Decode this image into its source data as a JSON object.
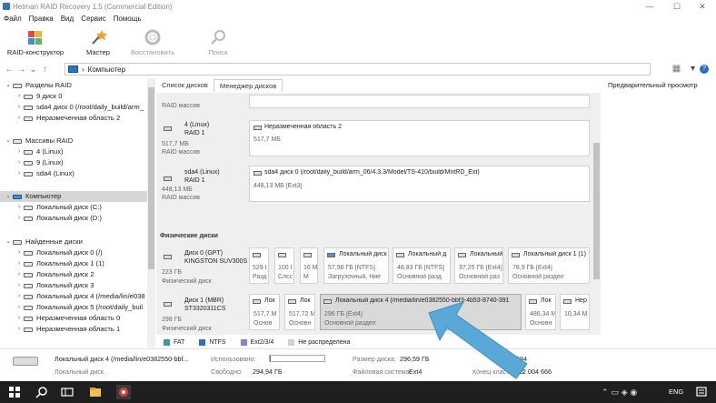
{
  "window": {
    "title": "Hetman RAID Recovery 1.5 (Commercial Edition)",
    "min": "—",
    "max": "☐",
    "close": "✕"
  },
  "menu": [
    "Файл",
    "Правка",
    "Вид",
    "Сервис",
    "Помощь"
  ],
  "toolbar": {
    "raid_builder": "RAID-конструктор",
    "wizard": "Мастер",
    "restore": "Восстановить",
    "search": "Поиск"
  },
  "address": {
    "path": "Компьютер",
    "sep": "›"
  },
  "tree": {
    "raid_partitions": "Разделы RAID",
    "rp_items": [
      "9 диск 0",
      "sda4 диск 0 (/root/daily_build/arm_",
      "Неразмеченная область 2"
    ],
    "raid_arrays": "Массивы RAID",
    "ra_items": [
      "4 (Linux)",
      "9 (Linux)",
      "sda4 (Linux)"
    ],
    "computer": "Компьютер",
    "pc_items": [
      "Локальный диск (C:)",
      "Локальный диск (D:)"
    ],
    "found_disks": "Найденные диски",
    "fd_items": [
      "Локальный диск 0 (/)",
      "Локальный диск 1 (1)",
      "Локальный диск 2",
      "Локальный диск 3",
      "Локальный диск 4 (/media/lin/e038",
      "Локальный диск 5 (/root/daily_buil",
      "Неразмеченная область 0",
      "Неразмеченная область 1"
    ]
  },
  "tabs": {
    "disk_list": "Список дисков",
    "disk_manager": "Менеджер дисков",
    "preview": "Предварительный просмотр"
  },
  "manager": {
    "raid_label": "RAID массив",
    "raid1": {
      "name": "4 (Linux)",
      "type": "RAID 1",
      "size": "517,7 МБ",
      "kind": "RAID массив",
      "part": "Неразмеченная область 2",
      "part_size": "517,7 МБ"
    },
    "raid2": {
      "name": "sda4 (Linux)",
      "type": "RAID 1",
      "size": "448,13 МБ",
      "kind": "RAID массив",
      "part": "sda4 диск 0 (/root/daily_build/arm_06/4.3.3/Model/TS-410/build/MntRD_Ext)",
      "part_size": "448,13 МБ [Ext3]"
    },
    "physical": "Физические диски",
    "disk0": {
      "name": "Диск 0 (GPT)",
      "model": "KINGSTON SUV300S",
      "size": "223 ГБ",
      "kind": "Физический диск"
    },
    "disk0_parts": [
      {
        "t": "",
        "s": "529 I",
        "s2": "Разд"
      },
      {
        "t": "",
        "s": "100 I",
        "s2": "Слсс"
      },
      {
        "t": "",
        "s": "16 М",
        "s2": "М"
      },
      {
        "t": "Локальный диск",
        "s": "57,96 ГБ [NTFS]",
        "s2": "Загрузочный, Ние"
      },
      {
        "t": "Локальный д",
        "s": "48,83 ГБ [NTFS]",
        "s2": "Основной разд"
      },
      {
        "t": "Локальный",
        "s": "37,25 ГБ [Ext4]",
        "s2": "Основной раз"
      },
      {
        "t": "Локальный диск 1 (1)",
        "s": "78,9 ГБ [Ext4]",
        "s2": "Основной раздел"
      }
    ],
    "disk1": {
      "name": "Диск 1 (MBR)",
      "model": "ST3320311CS",
      "size": "298 ГБ",
      "kind": "Физический диск"
    },
    "disk1_parts": [
      {
        "t": "Лок",
        "s": "517,7 М",
        "s2": "Основ"
      },
      {
        "t": "Лок",
        "s": "517,72 М",
        "s2": "Основн"
      },
      {
        "t": "Локальный диск 4 (/media/lin/e0382550-bbf3-4b53-8740-391",
        "s": "296 ГБ [Ext4]",
        "s2": "Основной раздел"
      },
      {
        "t": "Лок",
        "s": "486,34 М",
        "s2": "Основн"
      },
      {
        "t": "Нер",
        "s": "10,34 М",
        "s2": ""
      }
    ]
  },
  "legend": [
    "FAT",
    "NTFS",
    "Ext2/3/4",
    "Не распределена"
  ],
  "legend_colors": [
    "#3a9b9b",
    "#2e6fc2",
    "#8e7bd1",
    "#d0d0d0"
  ],
  "status": {
    "name": "Локальный диск 4 (/media/lin/e0382550-bbf...",
    "kind": "Локальный диск",
    "used_label": "Использовано:",
    "free_label": "Свободно:",
    "free_val": "294,94 ГБ",
    "size_label": "Размер диска:",
    "size_val": "296,59 ГБ",
    "fs_label": "Файловая система:",
    "fs_val": "Ext4",
    "sector1": "2 120 584",
    "sector2_label": "Конец кластеров:",
    "sector2": "622 004 666",
    "used_fraction": 0.006
  },
  "taskbar": {
    "lang": "ENG",
    "time": ""
  }
}
